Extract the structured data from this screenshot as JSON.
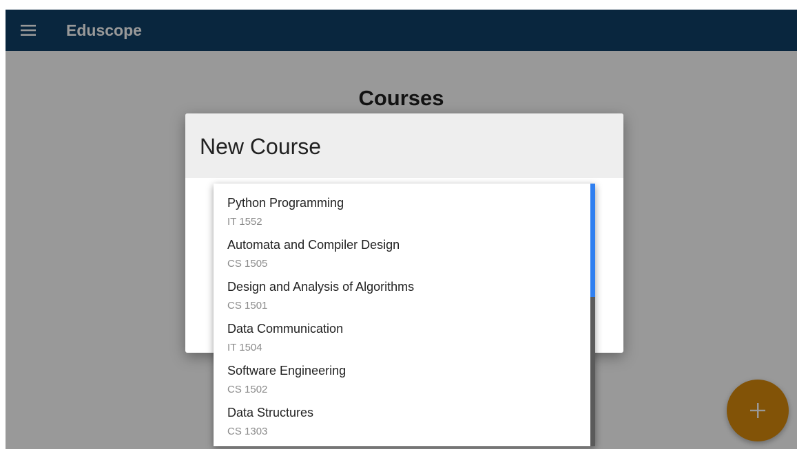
{
  "app": {
    "title": "Eduscope",
    "menu_icon": "hamburger-menu-icon"
  },
  "page": {
    "title": "Courses"
  },
  "dialog": {
    "title": "New Course"
  },
  "course_dropdown": {
    "options": [
      {
        "name": "Python Programming",
        "code": "IT 1552"
      },
      {
        "name": "Automata and Compiler Design",
        "code": "CS 1505"
      },
      {
        "name": "Design and Analysis of Algorithms",
        "code": "CS 1501"
      },
      {
        "name": "Data Communication",
        "code": "IT 1504"
      },
      {
        "name": "Software Engineering",
        "code": "CS 1502"
      },
      {
        "name": "Data Structures",
        "code": "CS 1303"
      }
    ]
  },
  "fab": {
    "icon": "plus-icon"
  },
  "colors": {
    "app_bar": "#0f4068",
    "fab": "#d98b0c",
    "scrollbar_thumb": "#2f7ff0"
  }
}
